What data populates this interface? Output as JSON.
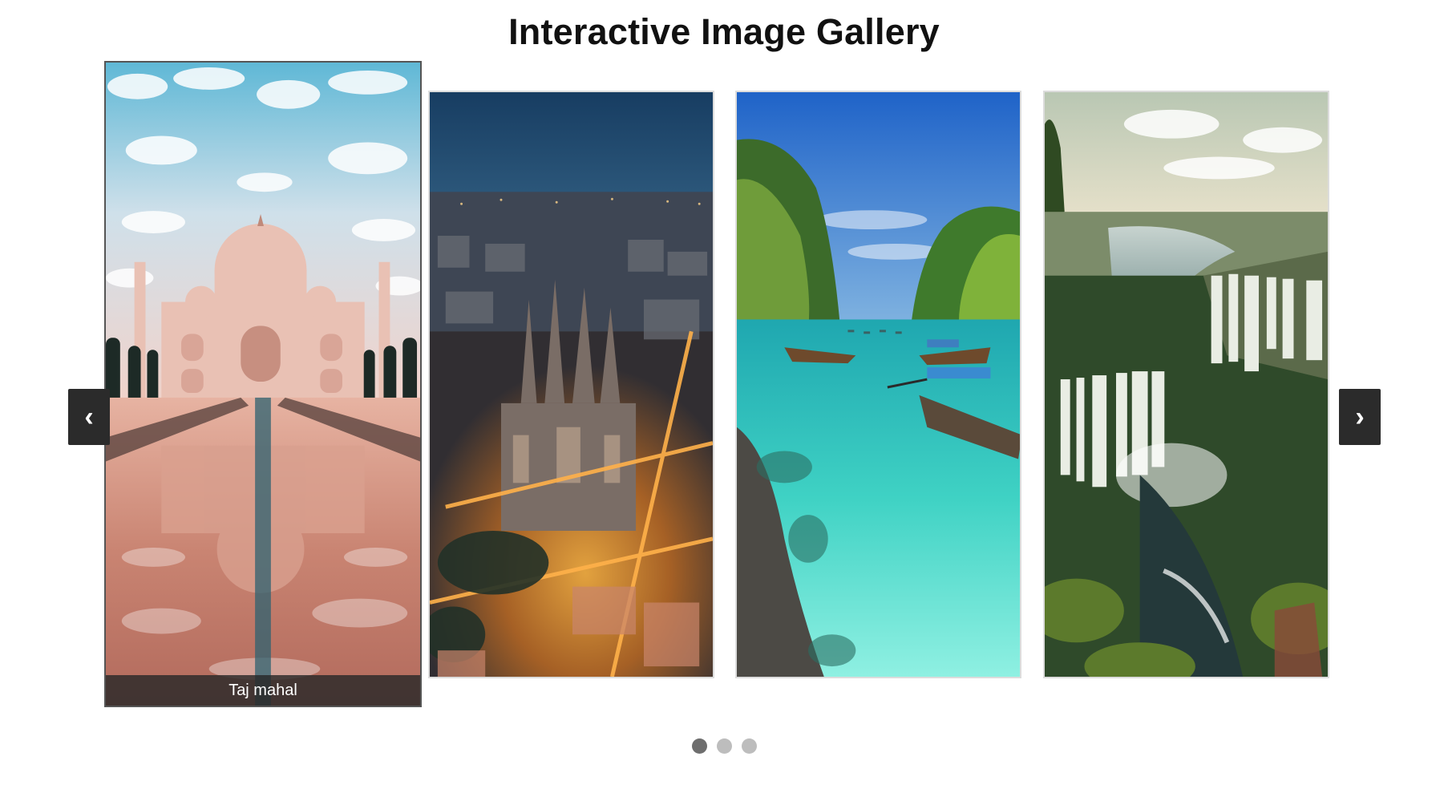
{
  "page": {
    "title": "Interactive Image Gallery"
  },
  "gallery": {
    "slides": [
      {
        "scene": "taj-mahal",
        "caption": "Taj mahal",
        "active": true
      },
      {
        "scene": "barcelona-night-city",
        "caption": "",
        "active": false
      },
      {
        "scene": "tropical-lagoon-boats",
        "caption": "",
        "active": false
      },
      {
        "scene": "waterfall-canyon",
        "caption": "",
        "active": false
      }
    ]
  },
  "controls": {
    "prev_label": "‹",
    "next_label": "›"
  },
  "pagination": {
    "count": 3,
    "active_index": 0
  },
  "colors": {
    "nav_bg": "#2b2b2b",
    "dot_active": "#6e6e6e",
    "dot_inactive": "#bdbdbd"
  }
}
